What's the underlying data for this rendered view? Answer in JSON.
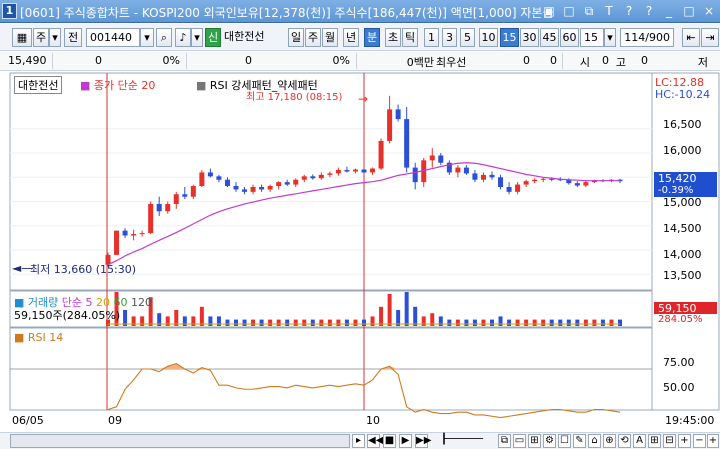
{
  "window": {
    "num": "1",
    "title": "[0601] 주식종합차트 - KOSPI200 외국인보유[12,378(천)] 주식수[186,447(천)] 액면[1,000] 자본금",
    "buttons": [
      "img-icon",
      "rect-icon",
      "copy-icon",
      "text-icon",
      "restore-icon",
      "help-icon",
      "min-icon",
      "max-icon",
      "close-icon"
    ]
  },
  "toolbar": {
    "type_select": "주",
    "type_dropdown": "▾",
    "whole_label": "전",
    "code": "001440",
    "new_badge": "신",
    "stock_name": "대한전선",
    "period_tabs": [
      "일",
      "주",
      "월",
      "년",
      "분",
      "초",
      "틱"
    ],
    "active_period": "분",
    "intervals": [
      "1",
      "3",
      "5",
      "10",
      "15",
      "30",
      "45",
      "60"
    ],
    "active_interval": "15",
    "interval_value": "15",
    "count": "114/900"
  },
  "inforow": {
    "values": [
      "15,490",
      "0",
      "0%",
      "0",
      "0%",
      "0백만",
      "최우선",
      "0",
      "0",
      "시",
      "0",
      "고",
      "0",
      "저"
    ]
  },
  "price_panel": {
    "stock_label": "대한전선",
    "ma_label": "종가 단순 20",
    "rsi_strength_label": "RSI 강세패턴_약세패턴",
    "high_label": "최고 17,180 (08:15)",
    "low_label": "최저 13,660 (15:30)",
    "lc_label": "LC:12.88",
    "hc_label": "HC:-10.24",
    "axis_ticks": [
      "16,500",
      "16,000",
      "15,500",
      "15,000",
      "14,500",
      "14,000",
      "13,500"
    ],
    "current_price": "15,420",
    "current_change": "-0.39%",
    "colors": {
      "up": "#e8302a",
      "down": "#2b4fd6",
      "ma": "#c13ad0",
      "marker": "#1f2a80"
    }
  },
  "volume_panel": {
    "label": "거래량",
    "ma_label": "단순 5",
    "ma2": "20",
    "ma3": "60",
    "ma4": "120",
    "current": "59,150주(284.05%)",
    "badge_value": "59,150",
    "badge_pct": "284.05%"
  },
  "rsi_panel": {
    "label": "RSI 14",
    "axis_ticks": [
      "75.00",
      "50.00"
    ]
  },
  "xaxis": {
    "labels": [
      "06/05",
      "09",
      "10"
    ],
    "time_label": "19:45:00"
  },
  "chart_data": {
    "type": "candlestick",
    "title": "대한전선",
    "ylim": [
      13300,
      17300
    ],
    "ma": "종가 단순 20",
    "candles": [
      {
        "o": 13700,
        "h": 13950,
        "l": 13660,
        "c": 13900
      },
      {
        "o": 13900,
        "h": 14400,
        "l": 13900,
        "c": 14400
      },
      {
        "o": 14400,
        "h": 14450,
        "l": 14250,
        "c": 14300
      },
      {
        "o": 14300,
        "h": 14420,
        "l": 14200,
        "c": 14330
      },
      {
        "o": 14330,
        "h": 14400,
        "l": 14280,
        "c": 14350
      },
      {
        "o": 14350,
        "h": 15000,
        "l": 14330,
        "c": 14950
      },
      {
        "o": 14950,
        "h": 15100,
        "l": 14700,
        "c": 14800
      },
      {
        "o": 14800,
        "h": 15000,
        "l": 14750,
        "c": 14950
      },
      {
        "o": 14950,
        "h": 15200,
        "l": 14850,
        "c": 15150
      },
      {
        "o": 15150,
        "h": 15300,
        "l": 15050,
        "c": 15100
      },
      {
        "o": 15100,
        "h": 15350,
        "l": 15050,
        "c": 15320
      },
      {
        "o": 15320,
        "h": 15650,
        "l": 15300,
        "c": 15600
      },
      {
        "o": 15600,
        "h": 15680,
        "l": 15500,
        "c": 15520
      },
      {
        "o": 15520,
        "h": 15550,
        "l": 15400,
        "c": 15450
      },
      {
        "o": 15450,
        "h": 15500,
        "l": 15300,
        "c": 15320
      },
      {
        "o": 15320,
        "h": 15400,
        "l": 15200,
        "c": 15250
      },
      {
        "o": 15250,
        "h": 15300,
        "l": 15150,
        "c": 15200
      },
      {
        "o": 15200,
        "h": 15350,
        "l": 15150,
        "c": 15300
      },
      {
        "o": 15300,
        "h": 15350,
        "l": 15200,
        "c": 15250
      },
      {
        "o": 15250,
        "h": 15350,
        "l": 15200,
        "c": 15320
      },
      {
        "o": 15320,
        "h": 15420,
        "l": 15250,
        "c": 15400
      },
      {
        "o": 15400,
        "h": 15450,
        "l": 15320,
        "c": 15350
      },
      {
        "o": 15350,
        "h": 15480,
        "l": 15300,
        "c": 15450
      },
      {
        "o": 15450,
        "h": 15550,
        "l": 15400,
        "c": 15520
      },
      {
        "o": 15520,
        "h": 15560,
        "l": 15450,
        "c": 15480
      },
      {
        "o": 15480,
        "h": 15600,
        "l": 15450,
        "c": 15550
      },
      {
        "o": 15550,
        "h": 15620,
        "l": 15500,
        "c": 15580
      },
      {
        "o": 15580,
        "h": 15700,
        "l": 15530,
        "c": 15650
      },
      {
        "o": 15650,
        "h": 15720,
        "l": 15600,
        "c": 15620
      },
      {
        "o": 15620,
        "h": 15680,
        "l": 15580,
        "c": 15660
      },
      {
        "o": 15660,
        "h": 15700,
        "l": 15580,
        "c": 15600
      },
      {
        "o": 15600,
        "h": 15700,
        "l": 15550,
        "c": 15680
      },
      {
        "o": 15680,
        "h": 16300,
        "l": 15650,
        "c": 16250
      },
      {
        "o": 16250,
        "h": 17180,
        "l": 16200,
        "c": 16900
      },
      {
        "o": 16900,
        "h": 17000,
        "l": 16650,
        "c": 16700
      },
      {
        "o": 16700,
        "h": 16950,
        "l": 15600,
        "c": 15700
      },
      {
        "o": 15700,
        "h": 15800,
        "l": 15250,
        "c": 15400
      },
      {
        "o": 15400,
        "h": 15900,
        "l": 15300,
        "c": 15850
      },
      {
        "o": 15850,
        "h": 16100,
        "l": 15700,
        "c": 15950
      },
      {
        "o": 15950,
        "h": 16000,
        "l": 15750,
        "c": 15800
      },
      {
        "o": 15800,
        "h": 15850,
        "l": 15550,
        "c": 15600
      },
      {
        "o": 15600,
        "h": 15750,
        "l": 15500,
        "c": 15700
      },
      {
        "o": 15700,
        "h": 15750,
        "l": 15550,
        "c": 15580
      },
      {
        "o": 15580,
        "h": 15650,
        "l": 15400,
        "c": 15450
      },
      {
        "o": 15450,
        "h": 15600,
        "l": 15400,
        "c": 15550
      },
      {
        "o": 15550,
        "h": 15620,
        "l": 15450,
        "c": 15500
      },
      {
        "o": 15500,
        "h": 15550,
        "l": 15250,
        "c": 15300
      },
      {
        "o": 15300,
        "h": 15400,
        "l": 15150,
        "c": 15200
      },
      {
        "o": 15200,
        "h": 15400,
        "l": 15150,
        "c": 15350
      },
      {
        "o": 15350,
        "h": 15450,
        "l": 15300,
        "c": 15420
      },
      {
        "o": 15420,
        "h": 15480,
        "l": 15380,
        "c": 15450
      },
      {
        "o": 15450,
        "h": 15500,
        "l": 15400,
        "c": 15470
      },
      {
        "o": 15470,
        "h": 15500,
        "l": 15420,
        "c": 15460
      },
      {
        "o": 15460,
        "h": 15500,
        "l": 15420,
        "c": 15450
      },
      {
        "o": 15450,
        "h": 15480,
        "l": 15350,
        "c": 15380
      },
      {
        "o": 15380,
        "h": 15420,
        "l": 15300,
        "c": 15330
      },
      {
        "o": 15330,
        "h": 15420,
        "l": 15300,
        "c": 15400
      },
      {
        "o": 15400,
        "h": 15450,
        "l": 15380,
        "c": 15440
      },
      {
        "o": 15440,
        "h": 15460,
        "l": 15400,
        "c": 15420
      },
      {
        "o": 15420,
        "h": 15460,
        "l": 15400,
        "c": 15450
      },
      {
        "o": 15450,
        "h": 15470,
        "l": 15380,
        "c": 15420
      }
    ],
    "ma_values": [
      13700,
      13780,
      13880,
      13960,
      14030,
      14120,
      14200,
      14280,
      14360,
      14450,
      14540,
      14630,
      14720,
      14790,
      14850,
      14900,
      14950,
      14990,
      15030,
      15070,
      15100,
      15130,
      15160,
      15190,
      15220,
      15250,
      15280,
      15310,
      15340,
      15370,
      15390,
      15410,
      15440,
      15490,
      15540,
      15570,
      15600,
      15640,
      15680,
      15720,
      15760,
      15790,
      15800,
      15790,
      15760,
      15720,
      15680,
      15640,
      15600,
      15560,
      15530,
      15500,
      15480,
      15460,
      15450,
      15440,
      15430,
      15430,
      15430,
      15430,
      15430
    ],
    "rsi_values": [
      40,
      42,
      55,
      62,
      70,
      70,
      68,
      72,
      74,
      70,
      67,
      71,
      69,
      58,
      58,
      56,
      55,
      55,
      56,
      57,
      57,
      56,
      58,
      57,
      56,
      57,
      58,
      57,
      58,
      59,
      58,
      62,
      70,
      72,
      66,
      42,
      38,
      40,
      38,
      37,
      37,
      38,
      38,
      36,
      36,
      35,
      34,
      35,
      36,
      37,
      38,
      39,
      40,
      40,
      39,
      38,
      38,
      40,
      40,
      39,
      38
    ],
    "volume_values": [
      2,
      14,
      5,
      3,
      3,
      9,
      4,
      3,
      5,
      3,
      3,
      6,
      3,
      3,
      2,
      2,
      2,
      2,
      2,
      2,
      2,
      2,
      2,
      2,
      2,
      2,
      2,
      2,
      2,
      2,
      2,
      3,
      6,
      10,
      5,
      14,
      6,
      3,
      4,
      3,
      2,
      2,
      2,
      2,
      2,
      2,
      3,
      2,
      2,
      2,
      2,
      2,
      2,
      2,
      2,
      2,
      2,
      2,
      2,
      2,
      2
    ]
  }
}
